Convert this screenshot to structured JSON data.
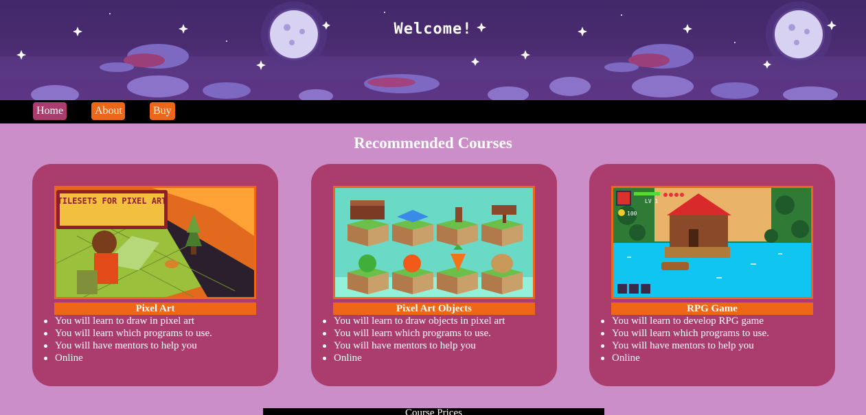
{
  "header": {
    "title": "Welcome!"
  },
  "nav": {
    "items": [
      "Home",
      "About",
      "Buy"
    ]
  },
  "section": {
    "title": "Recommended Courses"
  },
  "courses": [
    {
      "title": "Pixel Art",
      "image_caption": "TILESETS FOR PIXEL ART",
      "bullets": [
        "You will learn to draw in pixel art",
        "You will learn which programs to use.",
        "You will have mentors to help you",
        "Online"
      ]
    },
    {
      "title": "Pixel Art Objects",
      "bullets": [
        "You will learn to draw objects in pixel art",
        "You will learn which programs to use.",
        "You will have mentors to help you",
        "Online"
      ]
    },
    {
      "title": "RPG Game",
      "hud": {
        "level": "LV 1",
        "coins": "100"
      },
      "bullets": [
        "You will learn to develop RPG game",
        "You will learn which programs to use.",
        "You will have mentors to help you",
        "Online"
      ]
    }
  ],
  "footer": {
    "prices_label": "Course Prices"
  },
  "colors": {
    "page_bg": "#cc8ec8",
    "card_bg": "#aa3d6e",
    "accent": "#ee6617",
    "nav_bg": "#000000",
    "active_nav": "#aa3d6e"
  }
}
